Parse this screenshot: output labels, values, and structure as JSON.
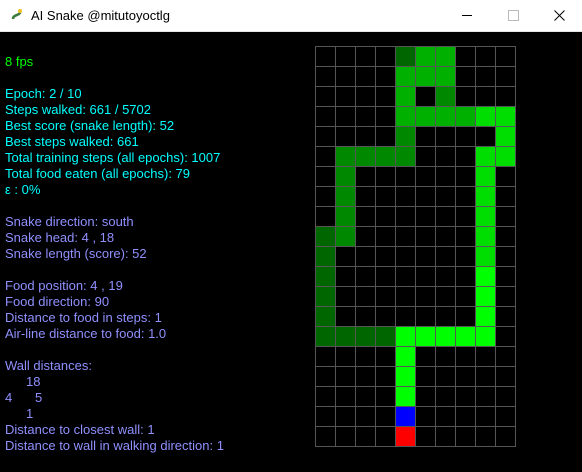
{
  "window": {
    "title": "AI Snake @mitutoyoctlg",
    "icon": "pygame-snake-icon",
    "minimize_icon": "minimize-icon",
    "maximize_icon": "maximize-icon",
    "close_icon": "close-icon"
  },
  "stats": {
    "fps": "8 fps",
    "epoch": "Epoch: 2 / 10",
    "steps_walked": "Steps walked: 661 / 5702",
    "best_score": "Best score (snake length): 52",
    "best_steps": "Best steps walked: 661",
    "total_training_steps": "Total training steps (all epochs): 1007",
    "total_food": "Total food eaten (all epochs): 79",
    "epsilon": "ε : 0%"
  },
  "snake_info": {
    "direction": "Snake direction: south",
    "head": "Snake head: 4 , 18",
    "length": "Snake length (score): 52"
  },
  "food_info": {
    "position": "Food position: 4 , 19",
    "direction": "Food direction: 90",
    "distance_steps": "Distance to food in steps: 1",
    "airline_distance": "Air-line distance to food: 1.0"
  },
  "walls": {
    "title": "Wall distances:",
    "north": "18",
    "west": "4",
    "east": "5",
    "south": "1",
    "closest": "Distance to closest wall: 1",
    "walking_direction": "Distance to wall in walking direction: 1"
  },
  "colors": {
    "background": "#000000",
    "grid_line": "#555555",
    "fps_text": "#00ff00",
    "stats_text": "#00ffff",
    "info_text": "#9090ff",
    "head": "#0000ff",
    "food": "#ff0000",
    "snake_gradient": [
      "#00ff00",
      "#00dd00",
      "#00b000",
      "#008800",
      "#006600"
    ]
  },
  "board": {
    "cols": 10,
    "rows": 20,
    "head": [
      4,
      18
    ],
    "food": [
      4,
      19
    ],
    "body": [
      [
        4,
        17
      ],
      [
        4,
        16
      ],
      [
        4,
        15
      ],
      [
        4,
        14
      ],
      [
        5,
        14
      ],
      [
        6,
        14
      ],
      [
        7,
        14
      ],
      [
        8,
        14
      ],
      [
        8,
        13
      ],
      [
        8,
        12
      ],
      [
        8,
        11
      ],
      [
        8,
        10
      ],
      [
        8,
        9
      ],
      [
        8,
        8
      ],
      [
        8,
        7
      ],
      [
        8,
        6
      ],
      [
        8,
        5
      ],
      [
        9,
        5
      ],
      [
        9,
        4
      ],
      [
        9,
        3
      ],
      [
        8,
        3
      ],
      [
        7,
        3
      ],
      [
        6,
        3
      ],
      [
        5,
        3
      ],
      [
        4,
        3
      ],
      [
        4,
        2
      ],
      [
        4,
        1
      ],
      [
        5,
        1
      ],
      [
        5,
        0
      ],
      [
        6,
        0
      ],
      [
        6,
        1
      ],
      [
        6,
        2
      ],
      [
        4,
        4
      ],
      [
        4,
        5
      ],
      [
        3,
        5
      ],
      [
        2,
        5
      ],
      [
        1,
        5
      ],
      [
        1,
        6
      ],
      [
        1,
        7
      ],
      [
        1,
        8
      ],
      [
        1,
        9
      ],
      [
        0,
        9
      ],
      [
        0,
        10
      ],
      [
        0,
        11
      ],
      [
        0,
        12
      ],
      [
        0,
        13
      ],
      [
        0,
        14
      ],
      [
        1,
        14
      ],
      [
        2,
        14
      ],
      [
        3,
        14
      ],
      [
        4,
        0
      ]
    ]
  }
}
